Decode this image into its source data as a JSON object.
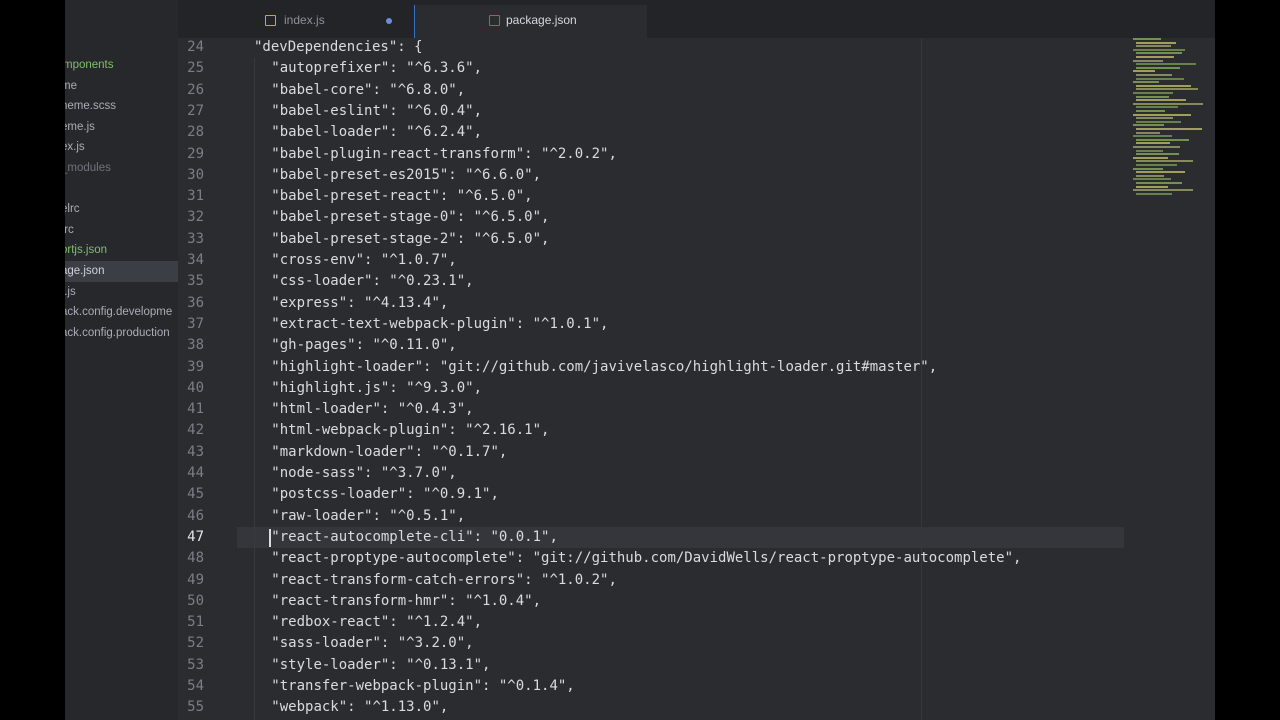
{
  "sidebar": {
    "items": [
      {
        "label": "mponents",
        "style": "green",
        "selected": false
      },
      {
        "label": "me",
        "style": "normal",
        "selected": false
      },
      {
        "label": "heme.scss",
        "style": "normal",
        "selected": false
      },
      {
        "label": "eme.js",
        "style": "normal",
        "selected": false
      },
      {
        "label": "ex.js",
        "style": "normal",
        "selected": false
      },
      {
        "label": "_modules",
        "style": "dim",
        "selected": false
      },
      {
        "label": "",
        "style": "normal",
        "selected": false
      },
      {
        "label": "elrc",
        "style": "normal",
        "selected": false
      },
      {
        "label": "trc",
        "style": "normal",
        "selected": false
      },
      {
        "label": "ortjs.json",
        "style": "green",
        "selected": false
      },
      {
        "label": "age.json",
        "style": "normal",
        "selected": true
      },
      {
        "label": "r.js",
        "style": "normal",
        "selected": false
      },
      {
        "label": "ack.config.developme",
        "style": "normal",
        "selected": false
      },
      {
        "label": "ack.config.production",
        "style": "normal",
        "selected": false
      }
    ]
  },
  "tabs": [
    {
      "label": "index.js",
      "icon": "js-file-icon",
      "icon_color": "#c0a36a",
      "active": false,
      "modified": true
    },
    {
      "label": "package.json",
      "icon": "npm-file-icon",
      "icon_color": "#c94b5a",
      "active": true,
      "modified": false
    }
  ],
  "editor": {
    "current_line": 47,
    "lines": [
      {
        "n": "24",
        "indent": 1,
        "text": "\"devDependencies\": {"
      },
      {
        "n": "25",
        "indent": 2,
        "text": "\"autoprefixer\": \"^6.3.6\","
      },
      {
        "n": "26",
        "indent": 2,
        "text": "\"babel-core\": \"^6.8.0\","
      },
      {
        "n": "27",
        "indent": 2,
        "text": "\"babel-eslint\": \"^6.0.4\","
      },
      {
        "n": "28",
        "indent": 2,
        "text": "\"babel-loader\": \"^6.2.4\","
      },
      {
        "n": "29",
        "indent": 2,
        "text": "\"babel-plugin-react-transform\": \"^2.0.2\","
      },
      {
        "n": "30",
        "indent": 2,
        "text": "\"babel-preset-es2015\": \"^6.6.0\","
      },
      {
        "n": "31",
        "indent": 2,
        "text": "\"babel-preset-react\": \"^6.5.0\","
      },
      {
        "n": "32",
        "indent": 2,
        "text": "\"babel-preset-stage-0\": \"^6.5.0\","
      },
      {
        "n": "33",
        "indent": 2,
        "text": "\"babel-preset-stage-2\": \"^6.5.0\","
      },
      {
        "n": "34",
        "indent": 2,
        "text": "\"cross-env\": \"^1.0.7\","
      },
      {
        "n": "35",
        "indent": 2,
        "text": "\"css-loader\": \"^0.23.1\","
      },
      {
        "n": "36",
        "indent": 2,
        "text": "\"express\": \"^4.13.4\","
      },
      {
        "n": "37",
        "indent": 2,
        "text": "\"extract-text-webpack-plugin\": \"^1.0.1\","
      },
      {
        "n": "38",
        "indent": 2,
        "text": "\"gh-pages\": \"^0.11.0\","
      },
      {
        "n": "39",
        "indent": 2,
        "text": "\"highlight-loader\": \"git://github.com/javivelasco/highlight-loader.git#master\","
      },
      {
        "n": "40",
        "indent": 2,
        "text": "\"highlight.js\": \"^9.3.0\","
      },
      {
        "n": "41",
        "indent": 2,
        "text": "\"html-loader\": \"^0.4.3\","
      },
      {
        "n": "42",
        "indent": 2,
        "text": "\"html-webpack-plugin\": \"^2.16.1\","
      },
      {
        "n": "43",
        "indent": 2,
        "text": "\"markdown-loader\": \"^0.1.7\","
      },
      {
        "n": "44",
        "indent": 2,
        "text": "\"node-sass\": \"^3.7.0\","
      },
      {
        "n": "45",
        "indent": 2,
        "text": "\"postcss-loader\": \"^0.9.1\","
      },
      {
        "n": "46",
        "indent": 2,
        "text": "\"raw-loader\": \"^0.5.1\","
      },
      {
        "n": "47",
        "indent": 2,
        "text": "\"react-autocomplete-cli\": \"0.0.1\","
      },
      {
        "n": "48",
        "indent": 2,
        "text": "\"react-proptype-autocomplete\": \"git://github.com/DavidWells/react-proptype-autocomplete\","
      },
      {
        "n": "49",
        "indent": 2,
        "text": "\"react-transform-catch-errors\": \"^1.0.2\","
      },
      {
        "n": "50",
        "indent": 2,
        "text": "\"react-transform-hmr\": \"^1.0.4\","
      },
      {
        "n": "51",
        "indent": 2,
        "text": "\"redbox-react\": \"^1.2.4\","
      },
      {
        "n": "52",
        "indent": 2,
        "text": "\"sass-loader\": \"^3.2.0\","
      },
      {
        "n": "53",
        "indent": 2,
        "text": "\"style-loader\": \"^0.13.1\","
      },
      {
        "n": "54",
        "indent": 2,
        "text": "\"transfer-webpack-plugin\": \"^0.1.4\","
      },
      {
        "n": "55",
        "indent": 2,
        "text": "\"webpack\": \"^1.13.0\","
      }
    ]
  },
  "colors": {
    "background": "#2a2c30",
    "text": "#d8dbe0",
    "accent_green": "#7fbf6a",
    "modified_dot": "#6b8fd6"
  }
}
